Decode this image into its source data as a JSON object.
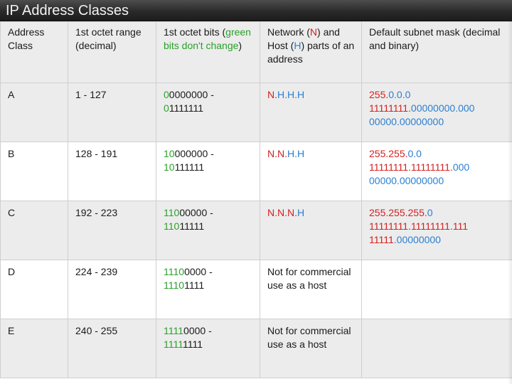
{
  "title": "IP Address Classes",
  "headers": {
    "class": "Address Class",
    "range": "1st octet range (decimal)",
    "bits_prefix": "1st octet bits (",
    "bits_green": "green bits don't change",
    "bits_suffix": ")",
    "nh_1": "Network (",
    "nh_n": "N",
    "nh_2": ") and Host (",
    "nh_h": "H",
    "nh_3": ") parts of an address",
    "mask": "Default subnet mask (decimal and binary)"
  },
  "colors": {
    "green": "#2aa12a",
    "network_red": "#d42020",
    "host_blue": "#2a7fd0",
    "title_bar": "#2a2a2a"
  },
  "rows": [
    {
      "cls": "A",
      "range": "1 - 127",
      "b1g": "0",
      "b1r": "0000000 -",
      "b2g": "0",
      "b2r": "1111111",
      "nh_net": "N.",
      "nh_host": "H.H.H",
      "m_dec_net": "255.",
      "m_dec_host": "0.0.0",
      "m_bin_net": "11111111.",
      "m_bin_host": "00000000.000",
      "m_bin_host2": "00000.00000000",
      "m_bin_net2": ""
    },
    {
      "cls": "B",
      "range": "128 - 191",
      "b1g": "10",
      "b1r": "000000 -",
      "b2g": "10",
      "b2r": "111111",
      "nh_net": "N.N.",
      "nh_host": "H.H",
      "m_dec_net": "255.255.",
      "m_dec_host": "0.0",
      "m_bin_net": "11111111.11111111.",
      "m_bin_host": "000",
      "m_bin_host2": "00000.00000000",
      "m_bin_net2": ""
    },
    {
      "cls": "C",
      "range": "192 - 223",
      "b1g": "110",
      "b1r": "00000 -",
      "b2g": "110",
      "b2r": "11111",
      "nh_net": "N.N.N.",
      "nh_host": "H",
      "m_dec_net": "255.255.255.",
      "m_dec_host": "0",
      "m_bin_net": "11111111.11111111.111",
      "m_bin_host": "",
      "m_bin_net2": "11111",
      "m_bin_host2": ".00000000"
    },
    {
      "cls": "D",
      "range": "224 - 239",
      "b1g": "1110",
      "b1r": "0000 -",
      "b2g": "1110",
      "b2r": "1111",
      "note": "Not for commercial use as a host"
    },
    {
      "cls": "E",
      "range": "240 - 255",
      "b1g": "1111",
      "b1r": "0000 -",
      "b2g": "1111",
      "b2r": "1111",
      "note": "Not for commercial use as a host"
    }
  ]
}
